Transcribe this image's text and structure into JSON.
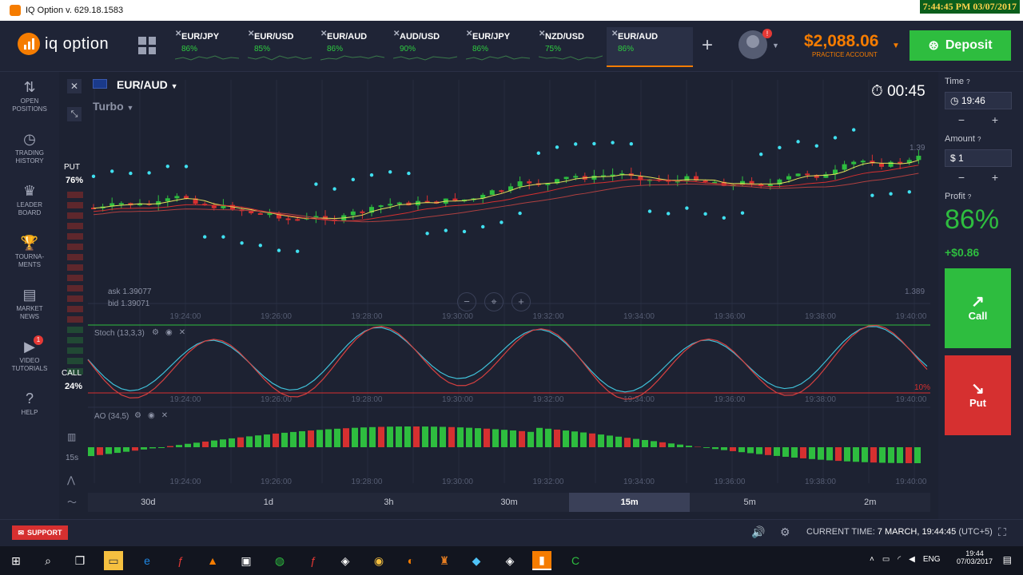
{
  "window": {
    "title": "IQ Option v. 629.18.1583",
    "minimize": "—",
    "maximize": "☐",
    "close": "✕"
  },
  "overlay_clock": "7:44:45 PM 03/07/2017",
  "logo": "iq option",
  "tabs": [
    {
      "pair": "EUR/JPY",
      "pct": "86%"
    },
    {
      "pair": "EUR/USD",
      "pct": "85%"
    },
    {
      "pair": "EUR/AUD",
      "pct": "86%"
    },
    {
      "pair": "AUD/USD",
      "pct": "90%"
    },
    {
      "pair": "EUR/JPY",
      "pct": "86%"
    },
    {
      "pair": "NZD/USD",
      "pct": "75%"
    },
    {
      "pair": "EUR/AUD",
      "pct": "86%"
    }
  ],
  "balance": {
    "value": "$2,088.06",
    "label": "PRACTICE ACCOUNT"
  },
  "deposit_label": "Deposit",
  "notification_count": "!",
  "sidebar": [
    {
      "line1": "OPEN",
      "line2": "POSITIONS",
      "icon": "⇅"
    },
    {
      "line1": "TRADING",
      "line2": "HISTORY",
      "icon": "◷"
    },
    {
      "line1": "LEADER",
      "line2": "BOARD",
      "icon": "♛"
    },
    {
      "line1": "TOURNA-",
      "line2": "MENTS",
      "icon": "🏆"
    },
    {
      "line1": "MARKET",
      "line2": "NEWS",
      "icon": "▤"
    },
    {
      "line1": "VIDEO",
      "line2": "TUTORIALS",
      "icon": "▶"
    },
    {
      "line1": "",
      "line2": "HELP",
      "icon": "?"
    }
  ],
  "video_badge": "1",
  "asset": {
    "pair": "EUR/AUD",
    "type": "Turbo"
  },
  "timer": "00:45",
  "put_side": {
    "label": "PUT",
    "pct": "76%"
  },
  "call_side": {
    "label": "CALL",
    "pct": "24%"
  },
  "quotes": {
    "ask": "ask 1.39077",
    "bid": "bid 1.39071"
  },
  "price_ticks": {
    "top": "1.39",
    "bottom": "1.389"
  },
  "time_ticks": [
    "19:24:00",
    "19:26:00",
    "19:28:00",
    "19:30:00",
    "19:32:00",
    "19:34:00",
    "19:36:00",
    "19:38:00",
    "19:40:00"
  ],
  "stoch": {
    "label": "Stoch (13,3,3)",
    "lower": "10%"
  },
  "ao": {
    "label": "AO (34,5)"
  },
  "chart_type": "candlestick",
  "candle_interval": "15s",
  "zoom_labels": [
    "−",
    "⌖",
    "+"
  ],
  "periods": [
    "30d",
    "1d",
    "3h",
    "30m",
    "15m",
    "5m",
    "2m"
  ],
  "active_period": "15m",
  "right": {
    "time_label": "Time",
    "time_value": "19:46",
    "amount_label": "Amount",
    "amount_value": "$ 1",
    "profit_label": "Profit",
    "profit_pct": "86%",
    "profit_value": "+$0.86",
    "call": "Call",
    "put": "Put"
  },
  "support": "SUPPORT",
  "current_time": {
    "label": "CURRENT TIME:",
    "value": "7 MARCH, 19:44:45",
    "tz": "(UTC+5)"
  },
  "tray": {
    "lang": "ENG",
    "time": "19:44",
    "date": "07/03/2017"
  },
  "colors": {
    "accent": "#f57c00",
    "green": "#2ebd3f",
    "red": "#d63030",
    "bg": "#1b1f2e"
  }
}
